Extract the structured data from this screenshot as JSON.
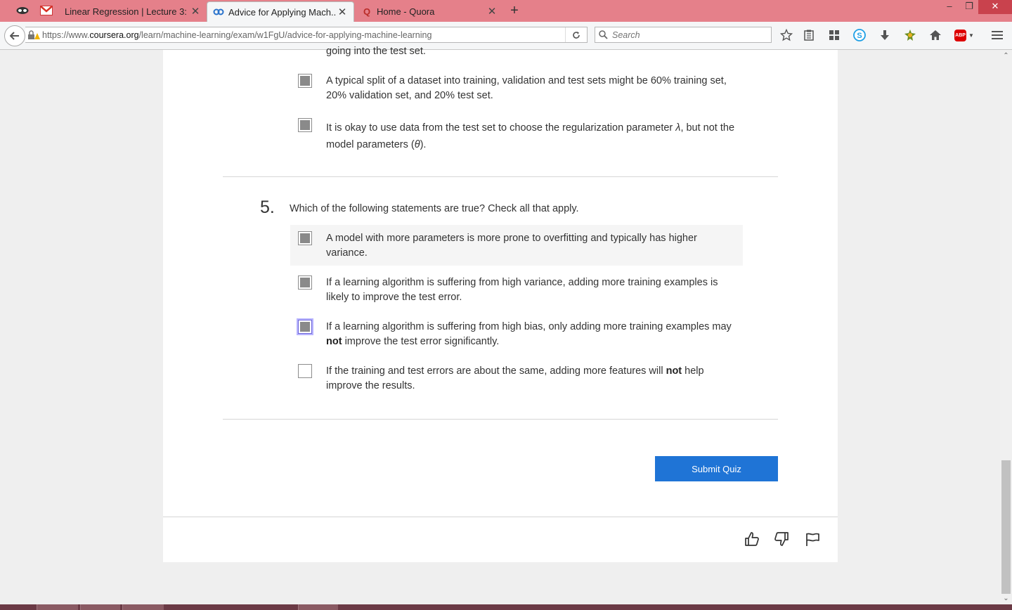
{
  "browser": {
    "tabs": [
      {
        "label": "Linear Regression | Lecture 3: L...",
        "icon": "gmail-icon"
      },
      {
        "label": "Advice for Applying Mach...",
        "icon": "coursera-icon",
        "active": true
      },
      {
        "label": "Home - Quora",
        "icon": "quora-icon",
        "icon_glyph": "Q"
      }
    ],
    "url": {
      "prefix": "https://www.",
      "domain": "coursera.org",
      "path": "/learn/machine-learning/exam/w1FgU/advice-for-applying-machine-learning"
    },
    "search_placeholder": "Search",
    "adblock_label": "ABP",
    "accent_colors": {
      "titlebar": "#e5808a",
      "close": "#c9424d",
      "submit": "#1f74d6"
    }
  },
  "quiz": {
    "prev_tail": "going into the test set.",
    "prev_options": [
      {
        "text": "A typical split of a dataset into training, validation and test sets might be 60% training set, 20% validation set, and 20% test set.",
        "checked": true
      },
      {
        "text_before": "It is okay to use data from the test set to choose the regularization parameter ",
        "lambda": "λ",
        "text_middle": ", but not the model parameters (",
        "theta": "θ",
        "text_after": ").",
        "checked": true
      }
    ],
    "question": {
      "number": "5.",
      "text": "Which of the following statements are true? Check all that apply.",
      "options": [
        {
          "text": "A model with more parameters is more prone to overfitting and typically has higher variance.",
          "checked": true
        },
        {
          "text": "If a learning algorithm is suffering from high variance, adding more training examples is likely to improve the test error.",
          "checked": true
        },
        {
          "text_before": "If a learning algorithm is suffering from high bias, only adding more training examples may ",
          "bold": "not",
          "text_after": " improve the test error significantly.",
          "checked": true
        },
        {
          "text_before": "If the training and test errors are about the same, adding more features will ",
          "bold": "not",
          "text_after": " help improve the results.",
          "checked": false
        }
      ]
    },
    "submit_label": "Submit Quiz"
  },
  "footer": {
    "icons": [
      "thumbs-up-icon",
      "thumbs-down-icon",
      "flag-icon"
    ]
  }
}
